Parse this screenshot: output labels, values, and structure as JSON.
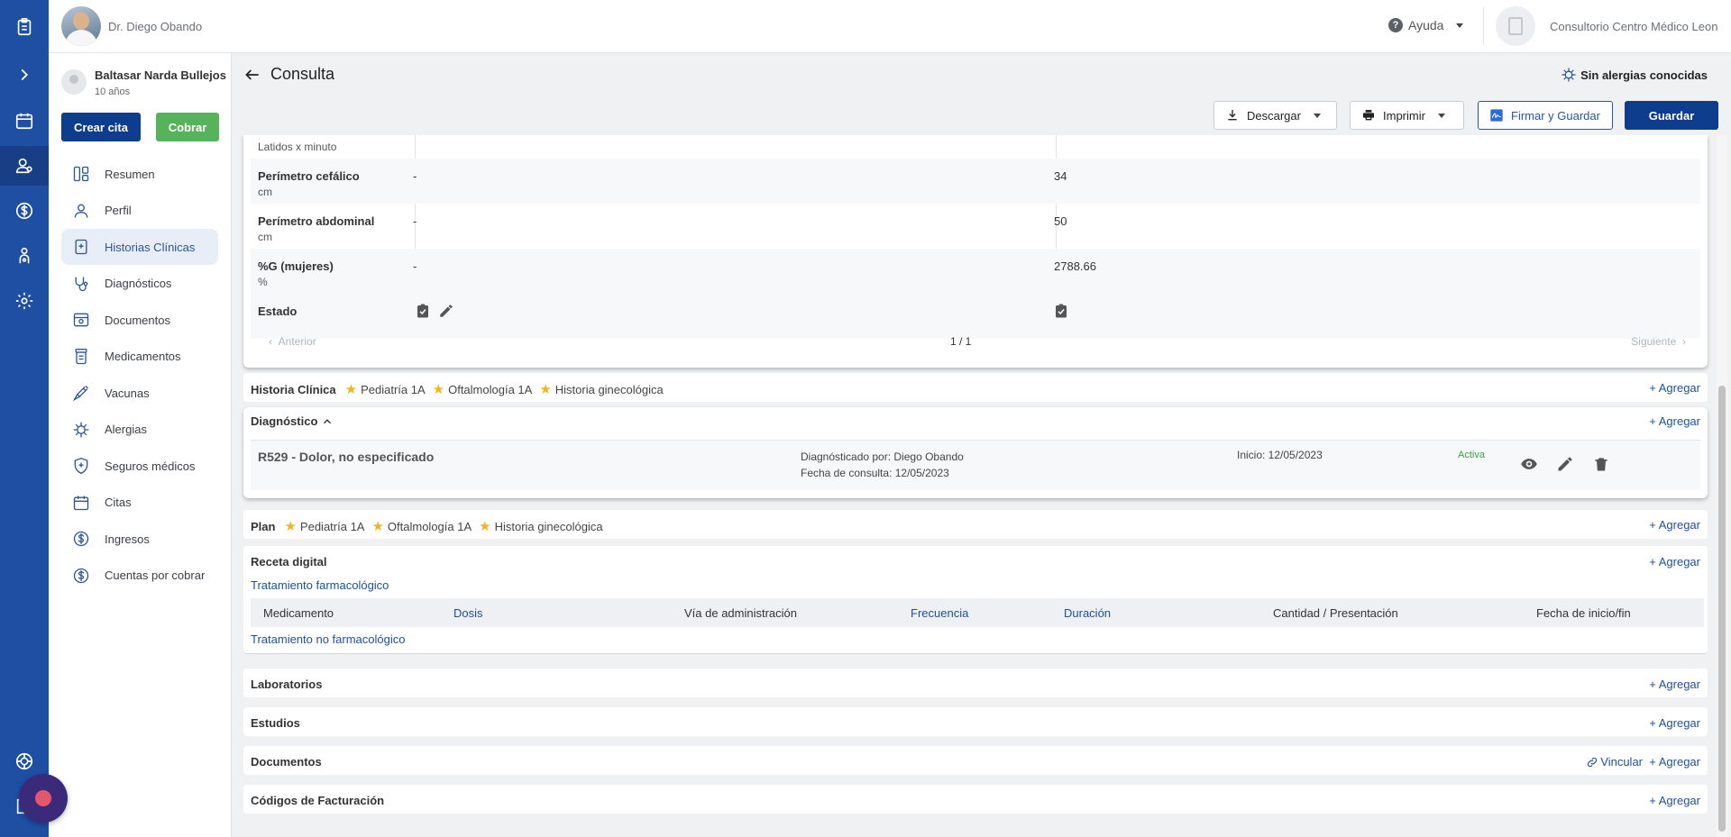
{
  "header": {
    "doctor_name": "Dr. Diego Obando",
    "help_label": "Ayuda",
    "clinic_name": "Consultorio Centro Médico Leon"
  },
  "patient": {
    "name": "Baltasar Narda Bullejos",
    "age": "10 años",
    "create_appointment": "Crear cita",
    "charge": "Cobrar"
  },
  "nav": [
    {
      "label": "Resumen",
      "icon": "summary-icon"
    },
    {
      "label": "Perfil",
      "icon": "profile-icon"
    },
    {
      "label": "Historias Clínicas",
      "icon": "clinical-history-icon",
      "active": true
    },
    {
      "label": "Diagnósticos",
      "icon": "stethoscope-icon"
    },
    {
      "label": "Documentos",
      "icon": "documents-icon"
    },
    {
      "label": "Medicamentos",
      "icon": "medication-icon"
    },
    {
      "label": "Vacunas",
      "icon": "syringe-icon"
    },
    {
      "label": "Alergias",
      "icon": "allergy-icon"
    },
    {
      "label": "Seguros médicos",
      "icon": "insurance-icon"
    },
    {
      "label": "Citas",
      "icon": "calendar-icon"
    },
    {
      "label": "Ingresos",
      "icon": "dollar-icon"
    },
    {
      "label": "Cuentas por cobrar",
      "icon": "receivables-icon"
    }
  ],
  "page": {
    "title": "Consulta",
    "allergy_status": "Sin alergias conocidas",
    "download": "Descargar",
    "print": "Imprimir",
    "sign_save": "Firmar y Guardar",
    "save": "Guardar"
  },
  "vitals": {
    "rows": [
      {
        "label": "",
        "unit": "Latidos x minuto",
        "val1": "",
        "val2": ""
      },
      {
        "label": "Perímetro cefálico",
        "unit": "cm",
        "val1": "-",
        "val2": "34"
      },
      {
        "label": "Perímetro abdominal",
        "unit": "cm",
        "val1": "-",
        "val2": "50"
      },
      {
        "label": "%G (mujeres)",
        "unit": "%",
        "val1": "-",
        "val2": "2788.66"
      },
      {
        "label": "Estado",
        "unit": "",
        "val1": "",
        "val2": ""
      }
    ],
    "pager_prev": "Anterior",
    "pager_count": "1 / 1",
    "pager_next": "Siguiente"
  },
  "sections": {
    "historia": {
      "title": "Historia Clínica",
      "tags": [
        "Pediatría 1A",
        "Oftalmología 1A",
        "Historia ginecológica"
      ]
    },
    "diagnostico": {
      "title": "Diagnóstico"
    },
    "plan": {
      "title": "Plan",
      "tags": [
        "Pediatría 1A",
        "Oftalmología 1A",
        "Historia ginecológica"
      ]
    },
    "receta": {
      "title": "Receta digital",
      "pharma": "Tratamiento farmacológico",
      "non_pharma": "Tratamiento no farmacológico"
    },
    "laboratorios": {
      "title": "Laboratorios"
    },
    "estudios": {
      "title": "Estudios"
    },
    "documentos": {
      "title": "Documentos",
      "link": "Vincular"
    },
    "codigos": {
      "title": "Códigos de Facturación"
    },
    "add_label": "+ Agregar"
  },
  "diagnosis": {
    "code": "R529 - Dolor, no especificado",
    "by": "Diagnósticado por: Diego Obando",
    "date": "Fecha de consulta: 12/05/2023",
    "start": "Inicio: 12/05/2023",
    "status": "Activa"
  },
  "prescription_columns": [
    "Medicamento",
    "Dosis",
    "Vía de administración",
    "Frecuencia",
    "Duración",
    "Cantidad / Presentación",
    "Fecha de inicio/fin"
  ]
}
